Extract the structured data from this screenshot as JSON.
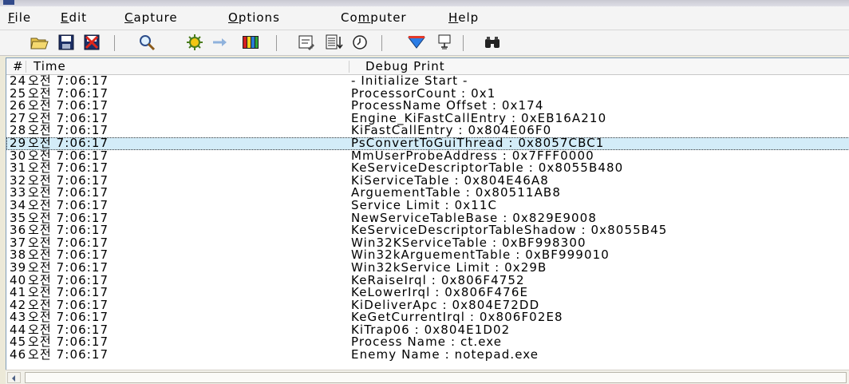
{
  "menu": {
    "file": {
      "mnemonic": "F",
      "rest": "ile"
    },
    "edit": {
      "mnemonic": "E",
      "rest": "dit"
    },
    "capture": {
      "mnemonic": "C",
      "rest": "apture"
    },
    "options": {
      "mnemonic": "O",
      "rest": "ptions"
    },
    "computer": {
      "pre": "Co",
      "mnemonic": "m",
      "rest": "puter"
    },
    "help": {
      "mnemonic": "H",
      "rest": "elp"
    }
  },
  "columns": {
    "num": "#",
    "time": "Time",
    "msg": "Debug Print"
  },
  "selected_row_index": 5,
  "rows": [
    {
      "num": "24",
      "time": "오전 7:06:17",
      "msg": "- Initialize Start -"
    },
    {
      "num": "25",
      "time": "오전 7:06:17",
      "msg": "ProcessorCount : 0x1"
    },
    {
      "num": "26",
      "time": "오전 7:06:17",
      "msg": "ProcessName Offset : 0x174"
    },
    {
      "num": "27",
      "time": "오전 7:06:17",
      "msg": "Engine_KiFastCallEntry : 0xEB16A210"
    },
    {
      "num": "28",
      "time": "오전 7:06:17",
      "msg": "KiFastCallEntry : 0x804E06F0"
    },
    {
      "num": "29",
      "time": "오전 7:06:17",
      "msg": "PsConvertToGuiThread : 0x8057CBC1"
    },
    {
      "num": "30",
      "time": "오전 7:06:17",
      "msg": "MmUserProbeAddress : 0x7FFF0000"
    },
    {
      "num": "31",
      "time": "오전 7:06:17",
      "msg": "KeServiceDescriptorTable : 0x8055B480"
    },
    {
      "num": "32",
      "time": "오전 7:06:17",
      "msg": "KiServiceTable : 0x804E46A8"
    },
    {
      "num": "33",
      "time": "오전 7:06:17",
      "msg": "ArguementTable : 0x80511AB8"
    },
    {
      "num": "34",
      "time": "오전 7:06:17",
      "msg": "Service  Limit : 0x11C"
    },
    {
      "num": "35",
      "time": "오전 7:06:17",
      "msg": "NewServiceTableBase : 0x829E9008"
    },
    {
      "num": "36",
      "time": "오전 7:06:17",
      "msg": "KeServiceDescriptorTableShadow : 0x8055B45"
    },
    {
      "num": "37",
      "time": "오전 7:06:17",
      "msg": "Win32KServiceTable : 0xBF998300"
    },
    {
      "num": "38",
      "time": "오전 7:06:17",
      "msg": "Win32kArguementTable : 0xBF999010"
    },
    {
      "num": "39",
      "time": "오전 7:06:17",
      "msg": "Win32kService  Limit : 0x29B"
    },
    {
      "num": "40",
      "time": "오전 7:06:17",
      "msg": "KeRaiseIrql : 0x806F4752"
    },
    {
      "num": "41",
      "time": "오전 7:06:17",
      "msg": "KeLowerIrql : 0x806F476E"
    },
    {
      "num": "42",
      "time": "오전 7:06:17",
      "msg": "KiDeliverApc : 0x804E72DD"
    },
    {
      "num": "43",
      "time": "오전 7:06:17",
      "msg": "KeGetCurrentIrql : 0x806F02E8"
    },
    {
      "num": "44",
      "time": "오전 7:06:17",
      "msg": "KiTrap06 : 0x804E1D02"
    },
    {
      "num": "45",
      "time": "오전 7:06:17",
      "msg": "Process Name : ct.exe"
    },
    {
      "num": "46",
      "time": "오전 7:06:17",
      "msg": "Enemy Name : notepad.exe"
    }
  ]
}
